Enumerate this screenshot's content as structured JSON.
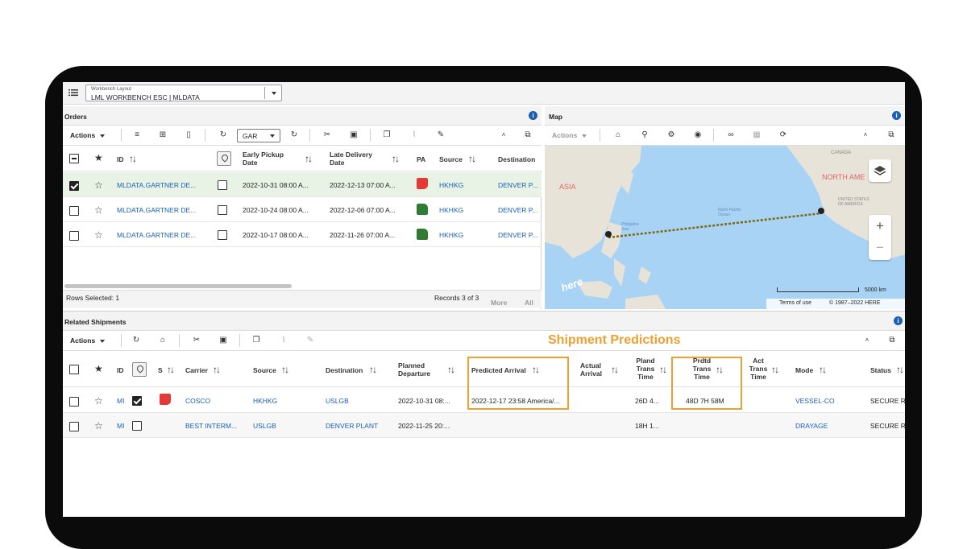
{
  "toolbar": {
    "layout_label": "Workbench Layout",
    "layout_value": "LML WORKBENCH ESC | MLDATA"
  },
  "orders": {
    "title": "Orders",
    "actions_label": "Actions",
    "filter_value": "GAR",
    "columns": {
      "id": "ID",
      "early_pickup": "Early Pickup Date",
      "late_delivery": "Late Delivery Date",
      "pa": "PA",
      "source": "Source",
      "destination": "Destination"
    },
    "rows": [
      {
        "id": "MLDATA.GARTNER DE...",
        "early": "2022-10-31 08:00 A...",
        "late": "2022-12-13 07:00 A...",
        "pa": "down",
        "source": "HKHKG",
        "dest": "DENVER P...",
        "selected": true
      },
      {
        "id": "MLDATA.GARTNER DE...",
        "early": "2022-10-24 08:00 A...",
        "late": "2022-12-06 07:00 A...",
        "pa": "up",
        "source": "HKHKG",
        "dest": "DENVER P...",
        "selected": false
      },
      {
        "id": "MLDATA.GARTNER DE...",
        "early": "2022-10-17 08:00 A...",
        "late": "2022-11-26 07:00 A...",
        "pa": "up",
        "source": "HKHKG",
        "dest": "DENVER P...",
        "selected": false
      }
    ],
    "rows_selected": "Rows Selected: 1",
    "records": "Records 3 of 3",
    "more": "More",
    "all": "All"
  },
  "map": {
    "title": "Map",
    "actions_label": "Actions",
    "labels": {
      "canada": "CANADA",
      "north_america": "NORTH AME",
      "usa": "UNITED STATES OF AMERICA",
      "asia": "ASIA",
      "north_pacific": "North Pacific Ocean",
      "philippine_sea": "Philippine Sea",
      "brand": "here"
    },
    "zoom_in": "+",
    "zoom_out": "−",
    "scale": "5000 km",
    "terms": "Terms of use",
    "copyright": "© 1987–2022 HERE"
  },
  "shipments": {
    "title": "Related Shipments",
    "actions_label": "Actions",
    "predictions_label": "Shipment Predictions",
    "columns": {
      "id": "ID",
      "s": "S",
      "carrier": "Carrier",
      "source": "Source",
      "destination": "Destination",
      "planned_departure": "Planned Departure",
      "predicted_arrival": "Predicted Arrival",
      "actual_arrival": "Actual Arrival",
      "pland_trans_time": "Pland Trans Time",
      "prdtd_trans_time": "Prdtd Trans Time",
      "act_trans_time": "Act Trans Time",
      "mode": "Mode",
      "status": "Status"
    },
    "rows": [
      {
        "id": "MI",
        "carrier": "COSCO",
        "source": "HKHKG",
        "dest": "USLGB",
        "planned_departure": "2022-10-31 08:...",
        "predicted_arrival": "2022-12-17 23:58 America/...",
        "pland_trans": "26D 4...",
        "prdtd_trans": "48D 7H 58M",
        "mode": "VESSEL-CO",
        "status": "SECURE R"
      },
      {
        "id": "MI",
        "carrier": "BEST INTERM...",
        "source": "USLGB",
        "dest": "DENVER PLANT",
        "planned_departure": "2022-11-25 20:...",
        "predicted_arrival": "",
        "pland_trans": "18H 1...",
        "prdtd_trans": "",
        "mode": "DRAYAGE",
        "status": "SECURE R"
      }
    ]
  },
  "colors": {
    "link": "#1a5fb4",
    "highlight_row": "#e8f3e6",
    "prediction_accent": "#f0a030",
    "thumb_up": "#2e7d32",
    "thumb_down": "#e53935",
    "ocean": "#a9d3f5",
    "land": "#e8e3d8",
    "route": "#7a6a10"
  }
}
